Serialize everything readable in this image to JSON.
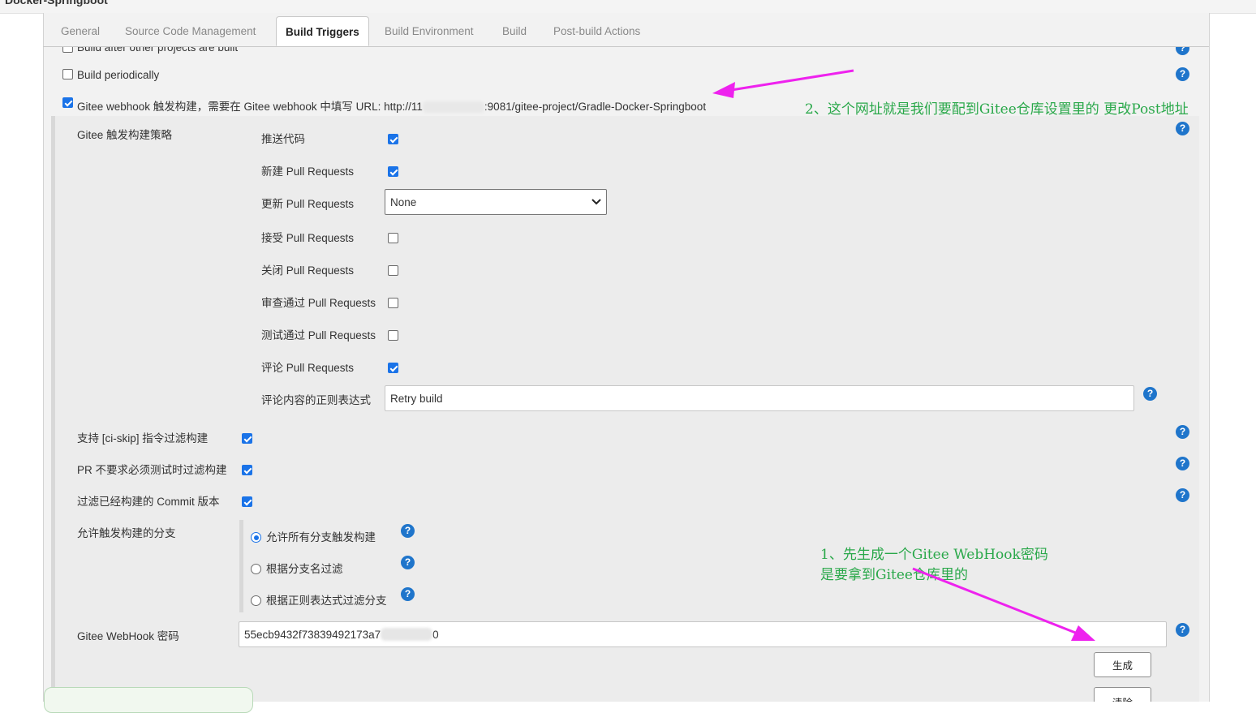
{
  "window": {
    "title": "Docker-Springboot"
  },
  "tabs": [
    "General",
    "Source Code Management",
    "Build Triggers",
    "Build Environment",
    "Build",
    "Post-build Actions"
  ],
  "triggers": {
    "build_after": "Build after other projects are built",
    "build_periodically": "Build periodically",
    "gitee_webhook_prefix": "Gitee webhook 触发构建，需要在 Gitee webhook 中填写 URL: http://11",
    "gitee_webhook_suffix": ":9081/gitee-project/Gradle-Docker-Springboot"
  },
  "strategy": {
    "label": "Gitee 触发构建策略",
    "items": [
      {
        "label": "推送代码",
        "checked": true
      },
      {
        "label": "新建 Pull Requests",
        "checked": true
      },
      {
        "label": "更新 Pull Requests",
        "select": "None"
      },
      {
        "label": "接受 Pull Requests",
        "checked": false
      },
      {
        "label": "关闭 Pull Requests",
        "checked": false
      },
      {
        "label": "审查通过 Pull Requests",
        "checked": false
      },
      {
        "label": "测试通过 Pull Requests",
        "checked": false
      },
      {
        "label": "评论 Pull Requests",
        "checked": true
      }
    ],
    "comment_regex_label": "评论内容的正则表达式",
    "comment_regex_value": "Retry build"
  },
  "filters": {
    "ci_skip": "支持 [ci-skip] 指令过滤构建",
    "pr_no_test": "PR 不要求必须测试时过滤构建",
    "built_commit": "过滤已经构建的 Commit 版本"
  },
  "branches": {
    "label": "允许触发构建的分支",
    "options": [
      "允许所有分支触发构建",
      "根据分支名过滤",
      "根据正则表达式过滤分支"
    ],
    "selected": 0
  },
  "webhook_secret": {
    "label": "Gitee WebHook 密码",
    "value": "55ecb9432f73839492173a7",
    "value_tail": "0",
    "generate_label": "生成",
    "clear_label": "清除"
  },
  "annotations": {
    "note1_line1": "1、先生成一个Gitee WebHook密码",
    "note1_line2": "是要拿到Gitee仓库里的",
    "note2": "2、这个网址就是我们要配到Gitee仓库设置里的 更改Post地址"
  },
  "colors": {
    "accent": "#1a73e8",
    "help": "#1f75cb",
    "annotation": "#2aa84a",
    "arrow": "#ee22ee"
  },
  "icons": {
    "help": "?",
    "chevron": "chevron-down-icon"
  }
}
